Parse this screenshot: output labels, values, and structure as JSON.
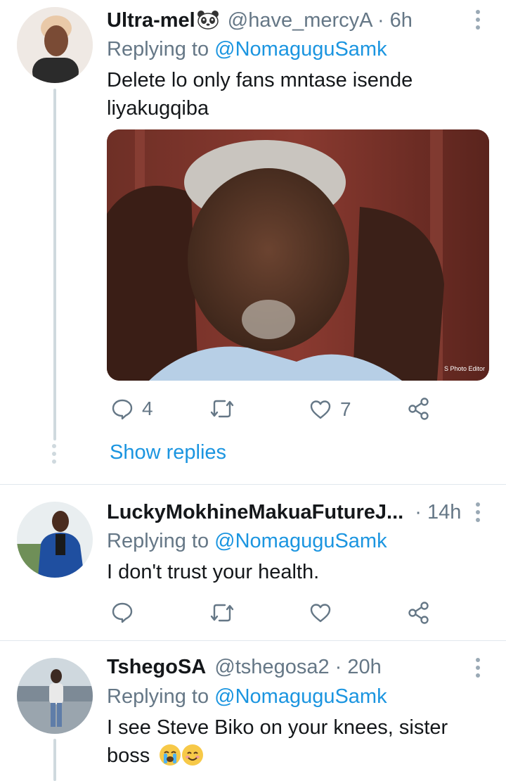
{
  "tweets": [
    {
      "display_name": "Ultra-mel",
      "handle": "@have_mercyA",
      "time": "· 6h",
      "replying_prefix": "Replying to",
      "replying_to": "@NomaguguSamk",
      "text": "Delete lo only fans mntase isende liyakugqiba",
      "media_watermark": "S Photo Editor",
      "replies": "4",
      "likes": "7",
      "show_replies": "Show replies"
    },
    {
      "display_name": "LuckyMokhineMakuaFutureJ...",
      "time": "· 14h",
      "replying_prefix": "Replying to",
      "replying_to": "@NomaguguSamk",
      "text": "I don't trust your health."
    },
    {
      "display_name": "TshegoSA",
      "handle": "@tshegosa2",
      "time": "· 20h",
      "replying_prefix": "Replying to",
      "replying_to": "@NomaguguSamk",
      "text": "I see Steve Biko on your knees, sister boss"
    }
  ],
  "colors": {
    "accent": "#1b95e0",
    "meta": "#657786",
    "divider": "#e1e8ed",
    "thread_line": "#cfd9de"
  },
  "icons": [
    "reply-icon",
    "retweet-icon",
    "like-icon",
    "share-icon",
    "more-icon",
    "panda-emoji",
    "crying-emoji",
    "smiling-emoji"
  ]
}
